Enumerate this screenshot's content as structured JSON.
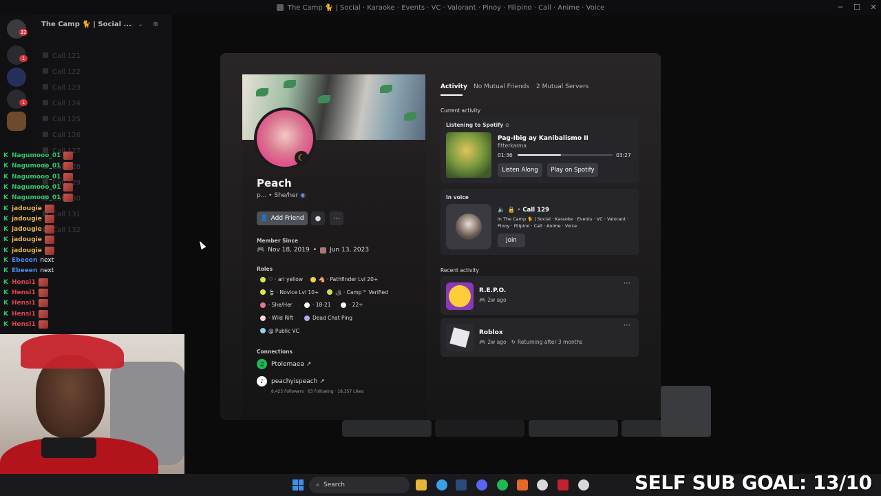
{
  "window": {
    "title": "The Camp 🐈 | Social · Karaoke · Events · VC · Valorant · Pinoy · Filipino · Call · Anime · Voice"
  },
  "server": {
    "name": "The Camp 🐈 | Social ..."
  },
  "rail": {
    "badges": [
      "32",
      "1",
      "1"
    ]
  },
  "channels": [
    "Call 121",
    "Call 122",
    "Call 123",
    "Call 124",
    "Call 125",
    "Call 126",
    "Call 127",
    "Call 128",
    "Call 129",
    "Call 130",
    "Call 131",
    "Call 132"
  ],
  "chat_overlay": [
    {
      "user": "Nagumooo_01",
      "color": "#2fc36b",
      "msg": ""
    },
    {
      "user": "Nagumooo_01",
      "color": "#2fc36b",
      "msg": ""
    },
    {
      "user": "Nagumooo_01",
      "color": "#2fc36b",
      "msg": ""
    },
    {
      "user": "Nagumooo_01",
      "color": "#2fc36b",
      "msg": ""
    },
    {
      "user": "Nagumooo_01",
      "color": "#2fc36b",
      "msg": ""
    },
    {
      "user": "jadougie",
      "color": "#e8b84b",
      "msg": ""
    },
    {
      "user": "jadougie",
      "color": "#e8b84b",
      "msg": ""
    },
    {
      "user": "jadougie",
      "color": "#e8b84b",
      "msg": ""
    },
    {
      "user": "jadougie",
      "color": "#e8b84b",
      "msg": ""
    },
    {
      "user": "jadougie",
      "color": "#e8b84b",
      "msg": ""
    },
    {
      "user": "Ebeeen",
      "color": "#4a8cf0",
      "msg": "next"
    },
    {
      "user": "Ebeeen",
      "color": "#4a8cf0",
      "msg": "next"
    },
    {
      "user": "Hensi1",
      "color": "#e0434d",
      "msg": ""
    },
    {
      "user": "Hensi1",
      "color": "#e0434d",
      "msg": ""
    },
    {
      "user": "Hensi1",
      "color": "#e0434d",
      "msg": ""
    },
    {
      "user": "Hensi1",
      "color": "#e0434d",
      "msg": ""
    },
    {
      "user": "Hensi1",
      "color": "#e0434d",
      "msg": ""
    }
  ],
  "profile": {
    "display_name": "Peach",
    "username": "p...",
    "pronouns": "She/her",
    "add_friend": "Add Friend",
    "member_since_label": "Member Since",
    "member_since_discord": "Nov 18, 2019",
    "member_since_server": "Jun 13, 2023",
    "roles_label": "Roles",
    "roles": [
      {
        "name": "♡ · ari yellow",
        "color": "#d6e34a"
      },
      {
        "name": "🐴 · Pathfinder Lvl 20+",
        "color": "#f0d24a"
      },
      {
        "name": "🍃 · Novice Lvl 10+",
        "color": "#e3e34a"
      },
      {
        "name": "🏕 · Camp™ Verified",
        "color": "#c9e34a"
      },
      {
        "name": "· She/Her",
        "color": "#e07a8a"
      },
      {
        "name": "· 18-21",
        "color": "#ffffff"
      },
      {
        "name": "· 22+",
        "color": "#ffffff"
      },
      {
        "name": "· Wild Rift",
        "color": "#f5d7dd"
      },
      {
        "name": "Dead Chat Ping",
        "color": "#b7a6f0"
      },
      {
        "name": "@ Public VC",
        "color": "#8fd0f0"
      }
    ],
    "connections_label": "Connections",
    "connections": [
      {
        "service": "spotify-icon",
        "name": "Ptolemaea ↗",
        "detail": ""
      },
      {
        "service": "tiktok-icon",
        "name": "peachyispeach ↗",
        "detail": "8,425 Followers · 63 Following · 18,357 Likes"
      }
    ]
  },
  "tabs": [
    "Activity",
    "No Mutual Friends",
    "2 Mutual Servers"
  ],
  "activity": {
    "current_label": "Current activity",
    "spotify": {
      "header": "Listening to Spotify",
      "track": "Pag-Ibig ay Kanibalismo II",
      "artist": "fitterkarma",
      "elapsed": "01:36",
      "duration": "03:27",
      "progress": 0.46,
      "listen_along": "Listen Along",
      "play_on_spotify": "Play on Spotify"
    },
    "voice": {
      "header": "In voice",
      "channel": "Call 129",
      "server_line": "in The Camp 🐈 | Social · Karaoke · Events · VC · Valorant · Pinoy · Filipino · Call · Anime · Voice",
      "join": "Join"
    },
    "recent_label": "Recent activity",
    "recent": [
      {
        "name": "R.E.P.O.",
        "time": "2w ago",
        "extra": ""
      },
      {
        "name": "Roblox",
        "time": "2w ago",
        "extra": "Returning after 3 months"
      }
    ]
  },
  "taskbar": {
    "search_placeholder": "Search"
  },
  "stream_overlay": {
    "goal": "SELF SUB GOAL: 13/10"
  }
}
